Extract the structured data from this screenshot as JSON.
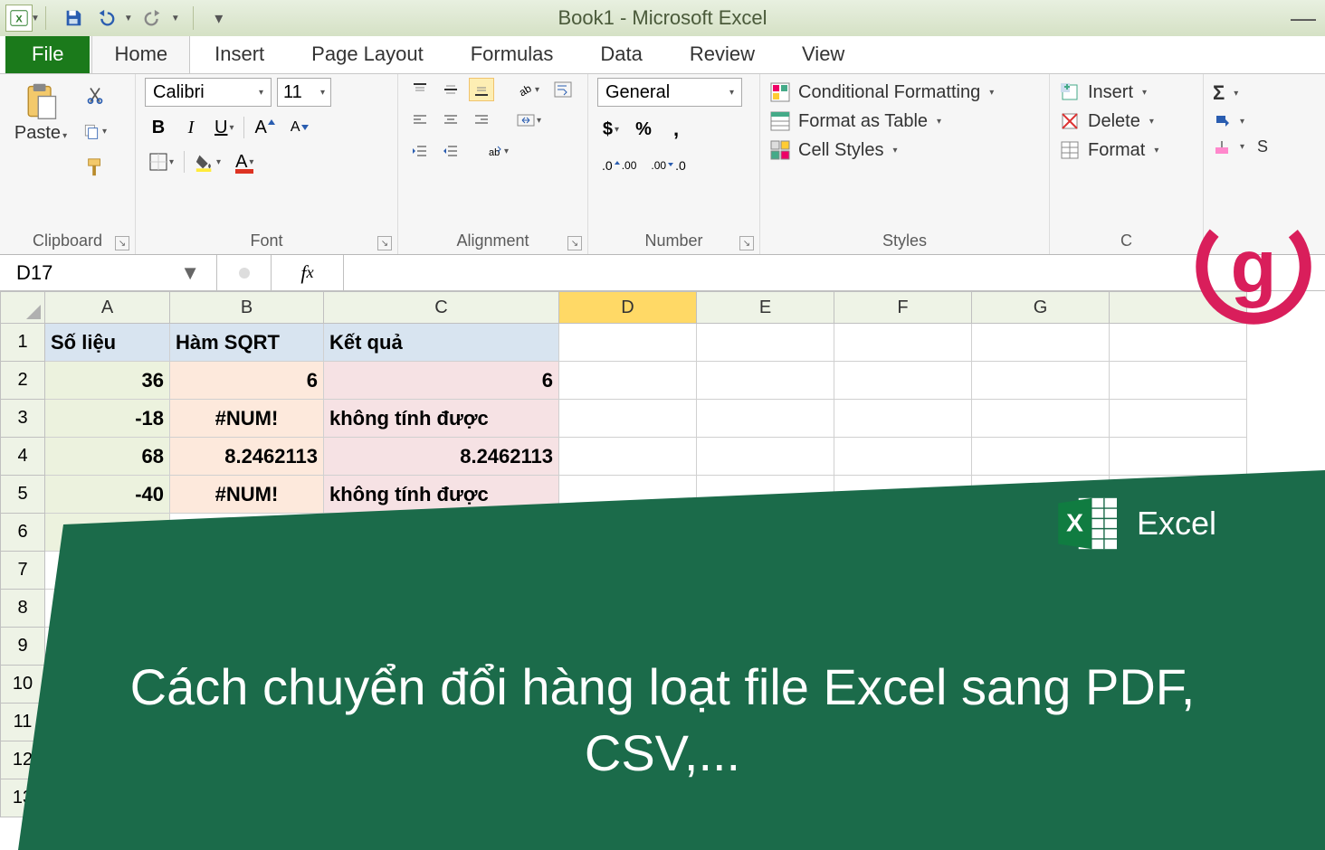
{
  "title": "Book1 - Microsoft Excel",
  "qat": [
    "save",
    "undo",
    "redo"
  ],
  "tabs": {
    "file": "File",
    "list": [
      "Home",
      "Insert",
      "Page Layout",
      "Formulas",
      "Data",
      "Review",
      "View"
    ],
    "active": "Home"
  },
  "clipboard": {
    "label": "Clipboard",
    "paste": "Paste"
  },
  "font": {
    "label": "Font",
    "name": "Calibri",
    "size": "11"
  },
  "alignment": {
    "label": "Alignment"
  },
  "number": {
    "label": "Number",
    "format": "General"
  },
  "styles": {
    "label": "Styles",
    "cond": "Conditional Formatting",
    "table": "Format as Table",
    "cell": "Cell Styles"
  },
  "cells": {
    "label": "C",
    "insert": "Insert",
    "delete": "Delete",
    "format": "Format"
  },
  "namebox": "D17",
  "columns": [
    "A",
    "B",
    "C",
    "D",
    "E",
    "F",
    "G"
  ],
  "activeCol": "D",
  "sheet": {
    "headers": [
      "Số liệu",
      "Hàm SQRT",
      "Kết quả"
    ],
    "rows": [
      {
        "a": "36",
        "b": "6",
        "c": "6",
        "bc_align": "right"
      },
      {
        "a": "-18",
        "b": "#NUM!",
        "c": "không tính được",
        "b_align": "center",
        "c_align": "left"
      },
      {
        "a": "68",
        "b": "8.2462113",
        "c": "8.2462113",
        "bc_align": "right"
      },
      {
        "a": "-40",
        "b": "#NUM!",
        "c": "không tính được",
        "b_align": "center",
        "c_align": "left"
      }
    ]
  },
  "banner": {
    "line": "Cách chuyển đổi hàng loạt file Excel sang PDF, CSV,...",
    "brand": "Excel"
  }
}
